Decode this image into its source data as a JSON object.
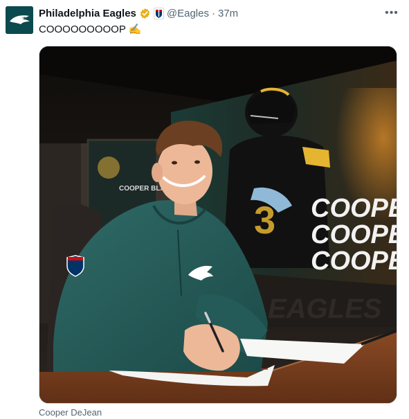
{
  "account": {
    "name": "Philadelphia Eagles",
    "handle": "@Eagles",
    "separator": "·",
    "timestamp": "37m",
    "avatar_icon": "eagles-logo-icon",
    "verified_icon": "verified-gold-badge-icon",
    "affiliate_icon": "nfl-shield-icon"
  },
  "menu": {
    "more_label": "•••"
  },
  "tweet": {
    "text": "COOOOOOOOOP",
    "emoji": "✍️"
  },
  "media": {
    "screen_text": [
      "COOPER",
      "COOPER",
      "COOPER"
    ],
    "wall_text": "EAGLES",
    "poster_text": "COOPER BLAKE"
  },
  "caption": {
    "text": "Cooper DeJean"
  },
  "colors": {
    "eagles_green": "#0b4a4f",
    "gold_verified": "#e8b21c",
    "muted": "#536471",
    "text": "#0f1419"
  }
}
